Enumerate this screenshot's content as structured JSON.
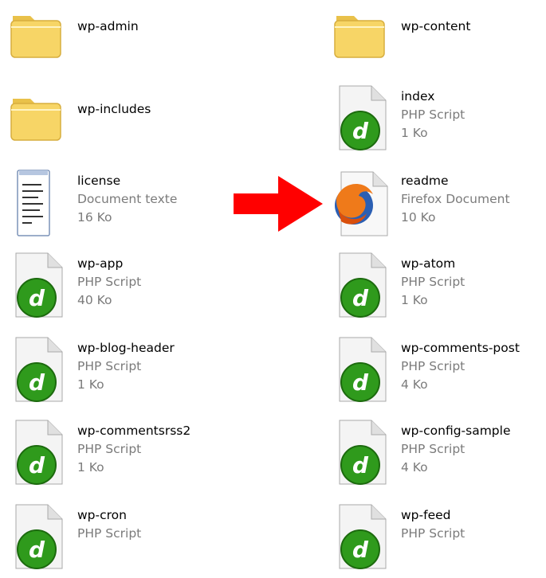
{
  "files": [
    {
      "name": "wp-admin",
      "type": "",
      "size": "",
      "icon": "folder-icon"
    },
    {
      "name": "wp-content",
      "type": "",
      "size": "",
      "icon": "folder-icon"
    },
    {
      "name": "wp-includes",
      "type": "",
      "size": "",
      "icon": "folder-icon"
    },
    {
      "name": "index",
      "type": "PHP Script",
      "size": "1 Ko",
      "icon": "dreamweaver-php-icon"
    },
    {
      "name": "license",
      "type": "Document texte",
      "size": "16 Ko",
      "icon": "text-document-icon"
    },
    {
      "name": "readme",
      "type": "Firefox Document",
      "size": "10 Ko",
      "icon": "firefox-document-icon"
    },
    {
      "name": "wp-app",
      "type": "PHP Script",
      "size": "40 Ko",
      "icon": "dreamweaver-php-icon"
    },
    {
      "name": "wp-atom",
      "type": "PHP Script",
      "size": "1 Ko",
      "icon": "dreamweaver-php-icon"
    },
    {
      "name": "wp-blog-header",
      "type": "PHP Script",
      "size": "1 Ko",
      "icon": "dreamweaver-php-icon"
    },
    {
      "name": "wp-comments-post",
      "type": "PHP Script",
      "size": "4 Ko",
      "icon": "dreamweaver-php-icon"
    },
    {
      "name": "wp-commentsrss2",
      "type": "PHP Script",
      "size": "1 Ko",
      "icon": "dreamweaver-php-icon"
    },
    {
      "name": "wp-config-sample",
      "type": "PHP Script",
      "size": "4 Ko",
      "icon": "dreamweaver-php-icon"
    },
    {
      "name": "wp-cron",
      "type": "PHP Script",
      "size": "",
      "icon": "dreamweaver-php-icon"
    },
    {
      "name": "wp-feed",
      "type": "PHP Script",
      "size": "",
      "icon": "dreamweaver-php-icon"
    }
  ],
  "colors": {
    "arrow": "#ff0000",
    "folder": "#f7d566",
    "php_green": "#2f9a1c",
    "secondary_text": "#7b7b7b"
  }
}
